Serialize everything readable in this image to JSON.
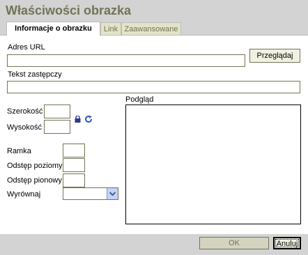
{
  "dialog": {
    "title": "Właściwości obrazka"
  },
  "tabs": [
    {
      "label": "Informacje o obrazku",
      "active": true
    },
    {
      "label": "Link",
      "active": false
    },
    {
      "label": "Zaawansowane",
      "active": false
    }
  ],
  "form": {
    "url_label": "Adres URL",
    "url_value": "",
    "browse_label": "Przeglądaj",
    "alt_label": "Tekst zastępczy",
    "alt_value": "",
    "width_label": "Szerokość",
    "width_value": "",
    "height_label": "Wysokość",
    "height_value": "",
    "border_label": "Ramka",
    "border_value": "",
    "hspace_label": "Odstęp poziomy",
    "hspace_value": "",
    "vspace_label": "Odstęp pionowy",
    "vspace_value": "",
    "align_label": "Wyrównaj",
    "align_value": "",
    "preview_label": "Podgląd"
  },
  "footer": {
    "ok_label": "OK",
    "cancel_label": "Anuluj"
  },
  "icons": {
    "lock": "lock-icon",
    "reset": "reset-size-icon",
    "dropdown": "chevron-down-icon"
  },
  "colors": {
    "title_text": "#737357",
    "chrome": "#d3d3d3",
    "panel": "#ffffff",
    "border": "#737357",
    "reset_icon": "#2b55c5"
  }
}
